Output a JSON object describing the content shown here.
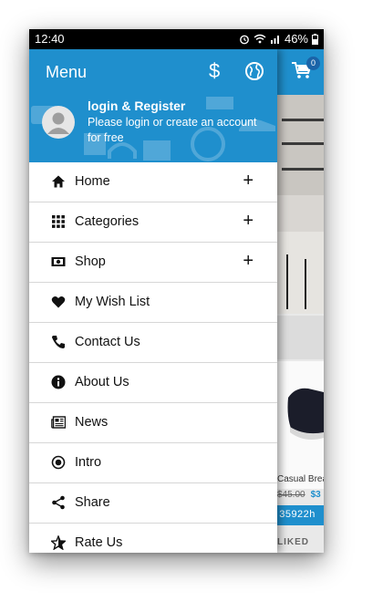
{
  "status_bar": {
    "time": "12:40",
    "battery": "46%"
  },
  "drawer": {
    "title": "Menu",
    "currency_icon": "$",
    "login_title": "login & Register",
    "login_subtitle": "Please login or create an account for free"
  },
  "menu": [
    {
      "label": "Home",
      "icon": "home-icon",
      "expandable": "+"
    },
    {
      "label": "Categories",
      "icon": "grid-icon",
      "expandable": "+"
    },
    {
      "label": "Shop",
      "icon": "money-icon",
      "expandable": "+"
    },
    {
      "label": "My Wish List",
      "icon": "heart-icon"
    },
    {
      "label": "Contact Us",
      "icon": "phone-icon"
    },
    {
      "label": "About Us",
      "icon": "info-icon"
    },
    {
      "label": "News",
      "icon": "newspaper-icon"
    },
    {
      "label": "Intro",
      "icon": "radio-icon"
    },
    {
      "label": "Share",
      "icon": "share-icon"
    },
    {
      "label": "Rate Us",
      "icon": "star-icon"
    }
  ],
  "background_app": {
    "cart_count": "0",
    "product_title": "Casual Brea",
    "price_old": "$45.00",
    "price_new": "$3",
    "code": "35922h",
    "liked_label": "LIKED"
  },
  "colors": {
    "primary": "#1f8fcd",
    "badge": "#1a63a8"
  }
}
